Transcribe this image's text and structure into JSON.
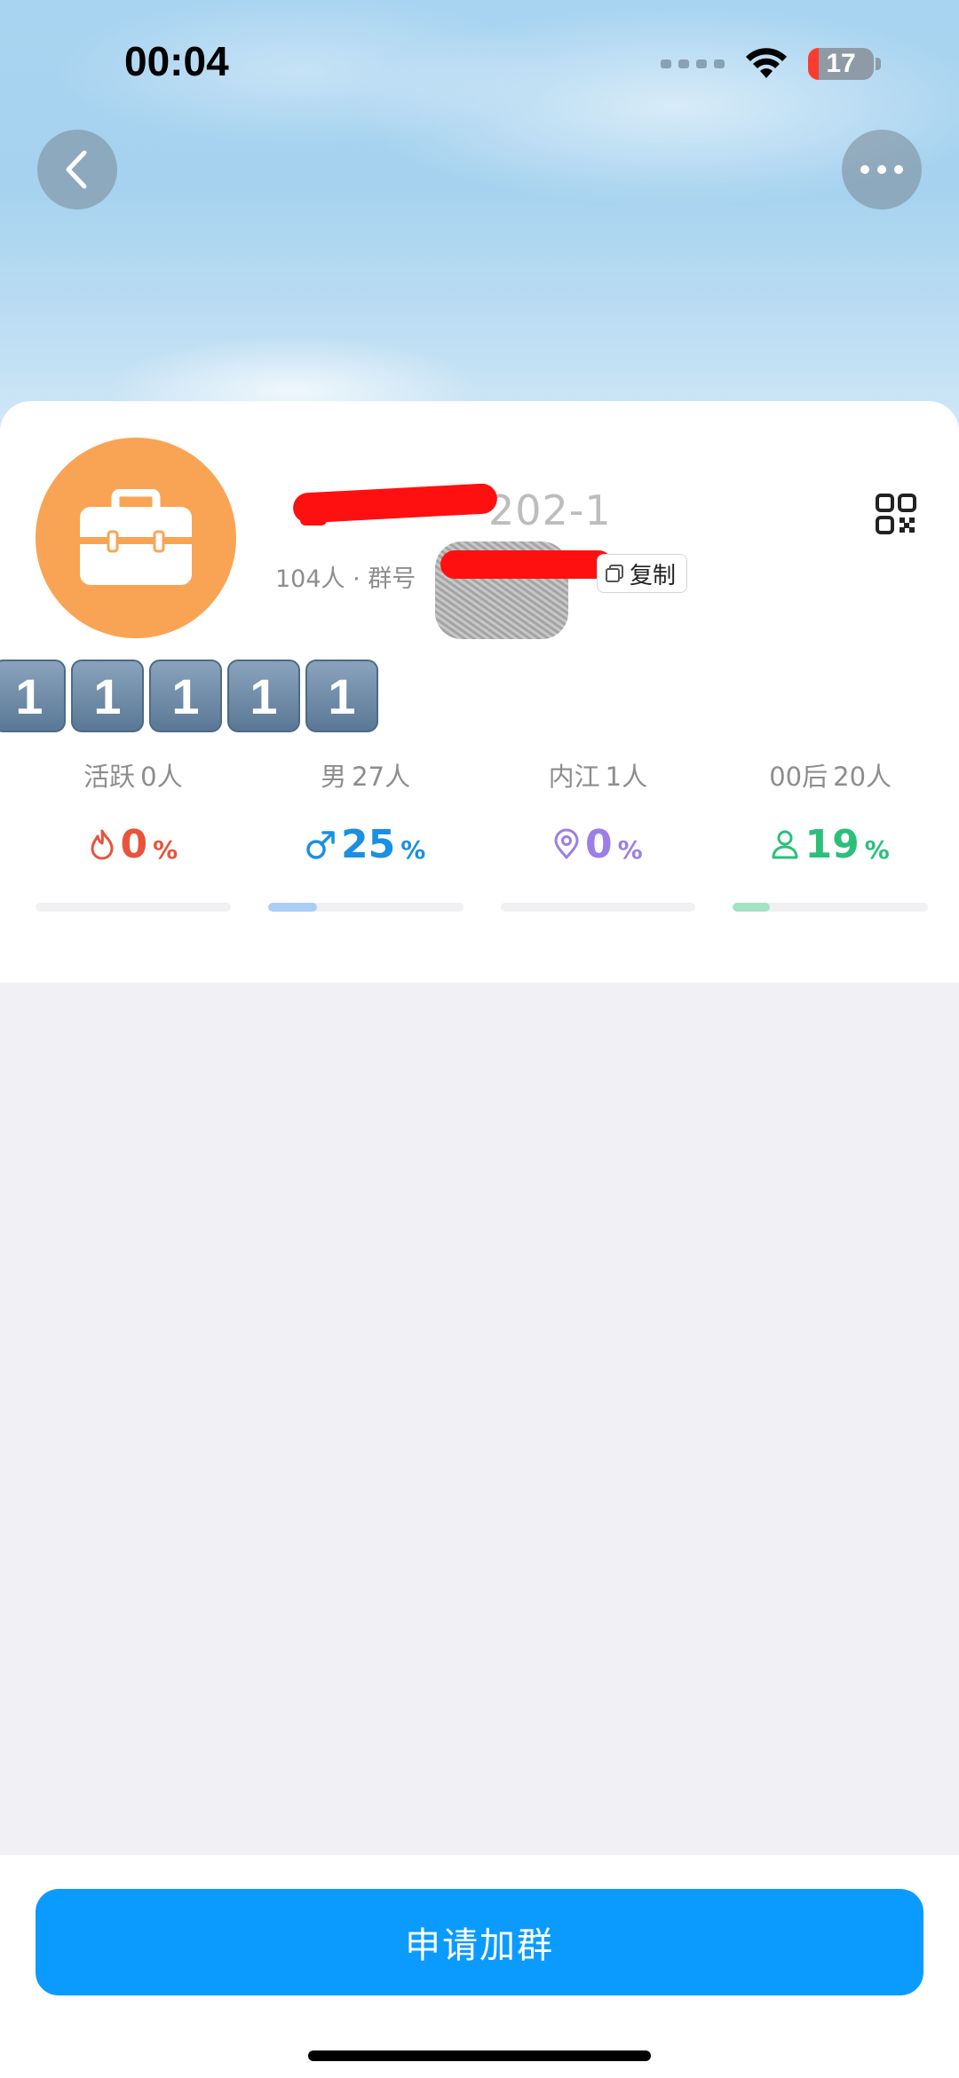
{
  "status_bar": {
    "time": "00:04",
    "battery": "17"
  },
  "group": {
    "name_visible": "202-1",
    "member_info": "104人 · 群号",
    "copy_label": "复制"
  },
  "tags": [
    "1",
    "1",
    "1",
    "1",
    "1"
  ],
  "stats": [
    {
      "label_key": "活跃",
      "label_value": "0人",
      "value": "0",
      "unit": "%",
      "icon": "flame-icon",
      "color": "#e8533a",
      "bar_fraction": 0
    },
    {
      "label_key": "男",
      "label_value": "27人",
      "value": "25",
      "unit": "%",
      "icon": "male-icon",
      "color": "#1a8fe3",
      "bar_fraction": 0.25
    },
    {
      "label_key": "内江",
      "label_value": "1人",
      "value": "0",
      "unit": "%",
      "icon": "location-pin-icon",
      "color": "#9b7fe6",
      "bar_fraction": 0
    },
    {
      "label_key": "00后",
      "label_value": "20人",
      "value": "19",
      "unit": "%",
      "icon": "person-icon",
      "color": "#2bc07a",
      "bar_fraction": 0.19
    }
  ],
  "bar_colors": {
    "male": "#a9cdf6",
    "person": "#a4e2c4"
  },
  "actions": {
    "join_label": "申请加群"
  }
}
